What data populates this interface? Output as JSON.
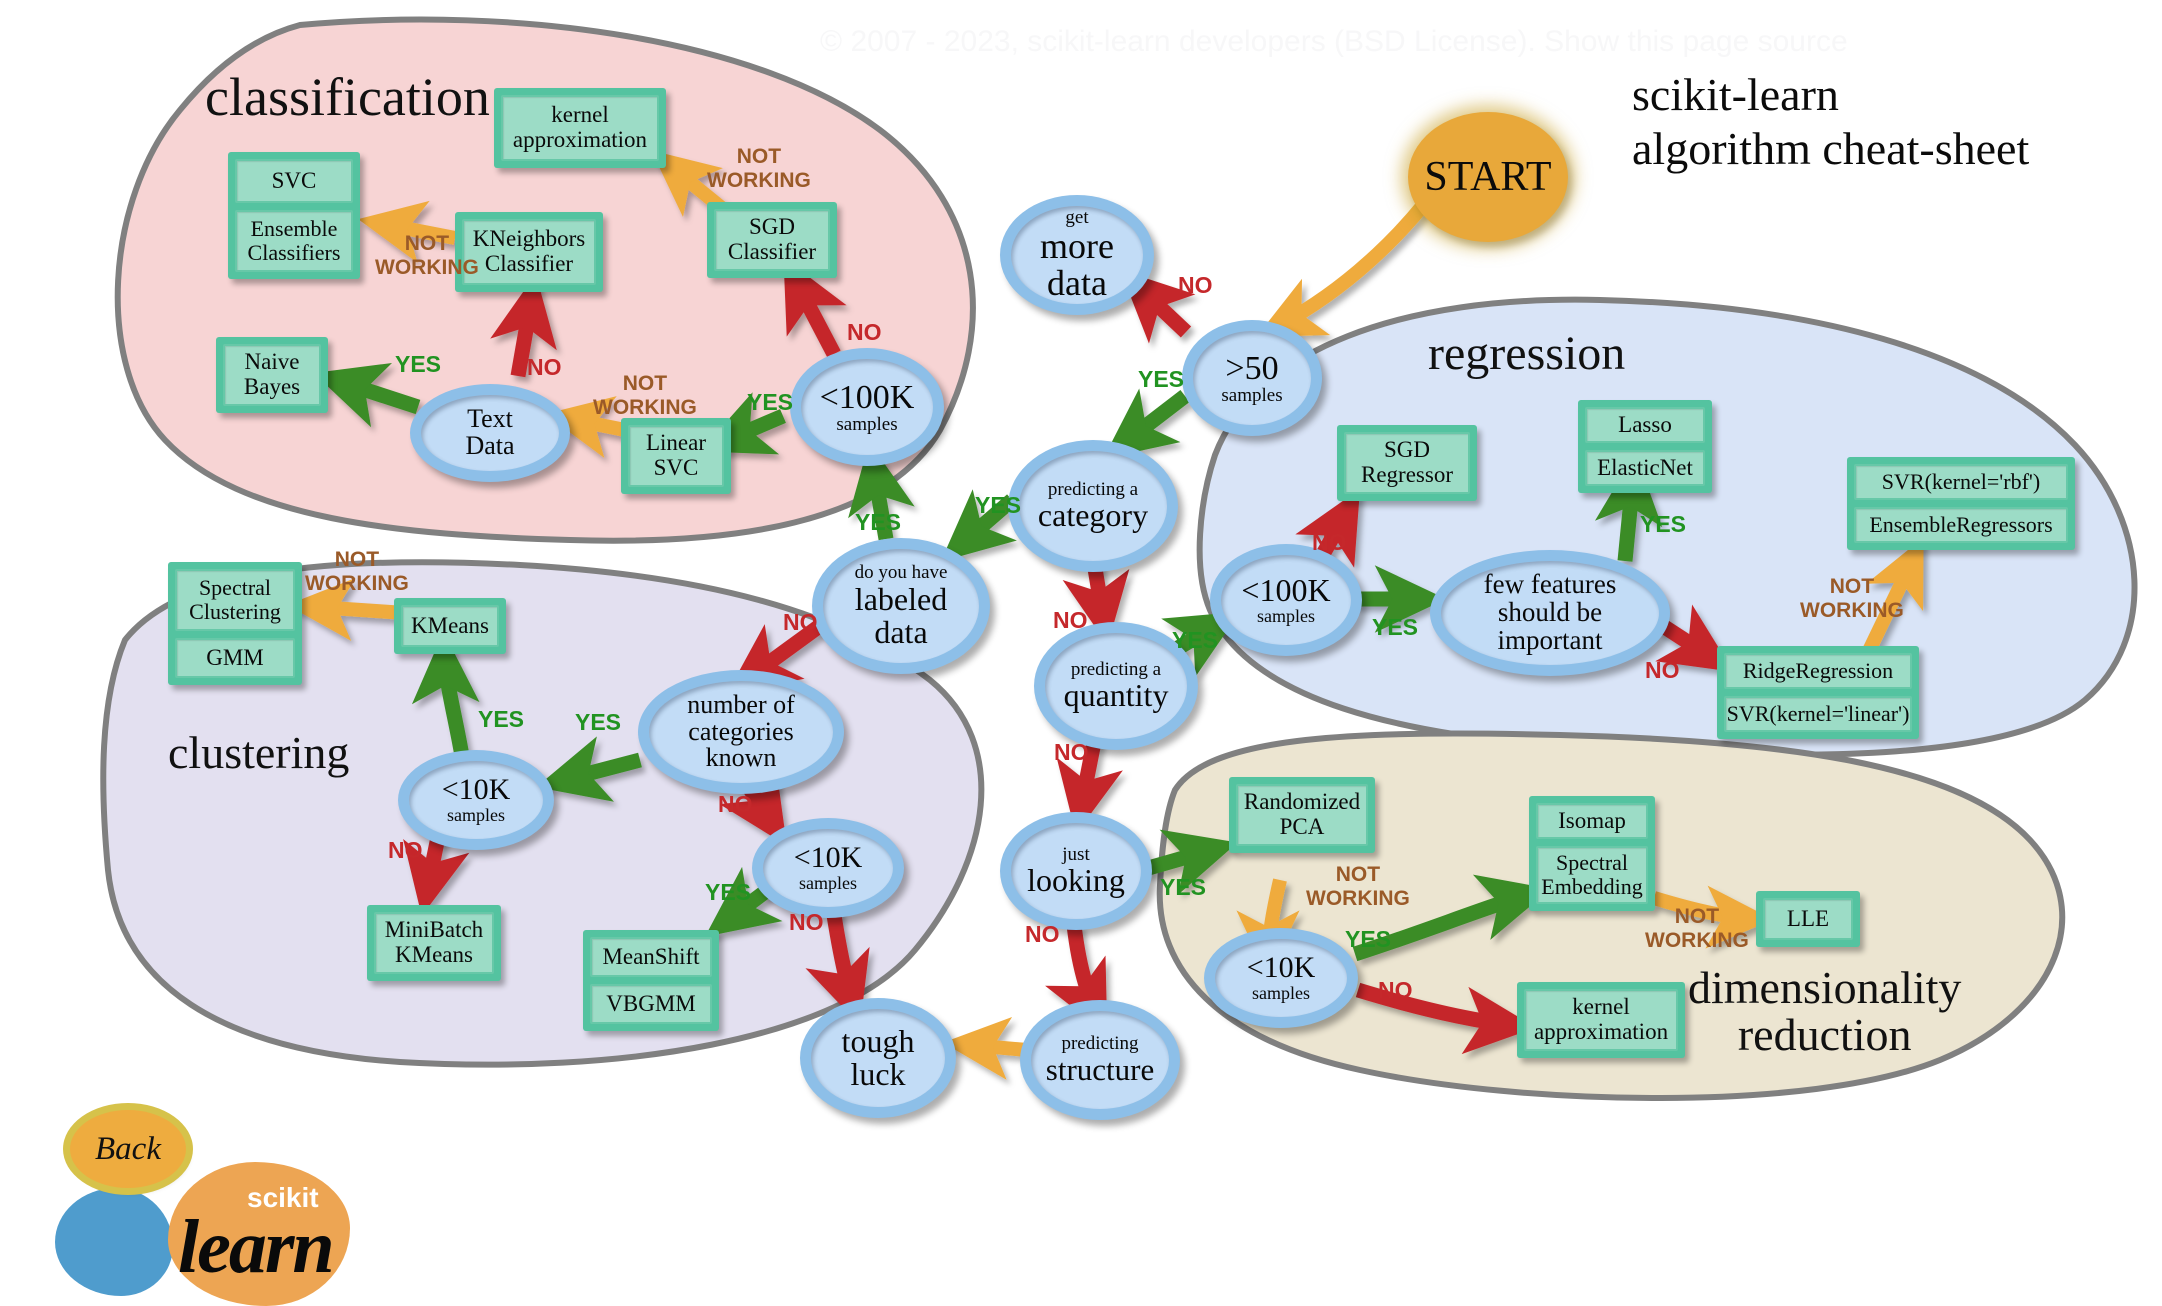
{
  "meta": {
    "watermark": "© 2007 - 2023, scikit-learn developers (BSD License). Show this page source",
    "title": "scikit-learn\nalgorithm cheat-sheet"
  },
  "colors": {
    "classification_fill": "#f7d4d4",
    "clustering_fill": "#e3e0f0",
    "regression_fill": "#d9e4f7",
    "dimreduction_fill": "#ece5d1",
    "region_stroke": "#808080",
    "box_border": "#54c3a0",
    "box_fill": "#9cdcc6",
    "node_ring": "#8dbfe8",
    "node_fill": "#c2dcf6",
    "start_fill": "#e8a83a",
    "arrow_yes": "#3a8c27",
    "arrow_no": "#c5282b",
    "arrow_notworking": "#efab3c",
    "label_yes": "#219321",
    "label_no": "#c5282b",
    "label_notworking": "#9a5a28"
  },
  "regions": [
    {
      "id": "classification",
      "label": "classification"
    },
    {
      "id": "clustering",
      "label": "clustering"
    },
    {
      "id": "regression",
      "label": "regression"
    },
    {
      "id": "dimensionality_reduction",
      "label": "dimensionality\nreduction"
    }
  ],
  "start": {
    "label": "START"
  },
  "logo": {
    "back_label": "Back",
    "scikit": "scikit",
    "learn": "learn"
  },
  "nodes": [
    {
      "id": "more_data",
      "sub": "get",
      "main": "more\ndata"
    },
    {
      "id": "gt50",
      "sub": "",
      "main": ">50",
      "post": "samples"
    },
    {
      "id": "predict_category",
      "sub": "predicting a",
      "main": "category"
    },
    {
      "id": "labeled_data",
      "sub": "do you have",
      "main": "labeled\ndata"
    },
    {
      "id": "predict_quantity",
      "sub": "predicting a",
      "main": "quantity"
    },
    {
      "id": "just_looking",
      "sub": "just",
      "main": "looking"
    },
    {
      "id": "predict_structure",
      "sub": "predicting",
      "main": "structure"
    },
    {
      "id": "tough_luck",
      "sub": "",
      "main": "tough\nluck"
    },
    {
      "id": "clf_lt100k",
      "sub": "",
      "main": "<100K",
      "post": "samples"
    },
    {
      "id": "text_data",
      "sub": "",
      "main": "Text\nData"
    },
    {
      "id": "reg_lt100k",
      "sub": "",
      "main": "<100K",
      "post": "samples"
    },
    {
      "id": "few_features",
      "sub": "",
      "main": "few features\nshould be\nimportant"
    },
    {
      "id": "num_categories",
      "sub": "",
      "main": "number of\ncategories\nknown"
    },
    {
      "id": "clu_lt10k_a",
      "sub": "",
      "main": "<10K",
      "post": "samples"
    },
    {
      "id": "clu_lt10k_b",
      "sub": "",
      "main": "<10K",
      "post": "samples"
    },
    {
      "id": "dim_lt10k",
      "sub": "",
      "main": "<10K",
      "post": "samples"
    }
  ],
  "boxes": [
    {
      "id": "kernel_approx_clf",
      "cells": [
        "kernel\napproximation"
      ]
    },
    {
      "id": "svc_ensemble",
      "cells": [
        "SVC",
        "Ensemble\nClassifiers"
      ]
    },
    {
      "id": "kneighbors",
      "cells": [
        "KNeighbors\nClassifier"
      ]
    },
    {
      "id": "sgd_classifier",
      "cells": [
        "SGD\nClassifier"
      ]
    },
    {
      "id": "naive_bayes",
      "cells": [
        "Naive\nBayes"
      ]
    },
    {
      "id": "linear_svc",
      "cells": [
        "Linear\nSVC"
      ]
    },
    {
      "id": "spectral_gmm",
      "cells": [
        "Spectral\nClustering",
        "GMM"
      ]
    },
    {
      "id": "kmeans",
      "cells": [
        "KMeans"
      ]
    },
    {
      "id": "minibatch_kmeans",
      "cells": [
        "MiniBatch\nKMeans"
      ]
    },
    {
      "id": "meanshift_vbgmm",
      "cells": [
        "MeanShift",
        "VBGMM"
      ]
    },
    {
      "id": "sgd_regressor",
      "cells": [
        "SGD\nRegressor"
      ]
    },
    {
      "id": "lasso_elasticnet",
      "cells": [
        "Lasso",
        "ElasticNet"
      ]
    },
    {
      "id": "svr_rbf_ensemble",
      "cells": [
        "SVR(kernel='rbf')",
        "EnsembleRegressors"
      ]
    },
    {
      "id": "ridge_svrlinear",
      "cells": [
        "RidgeRegression",
        "SVR(kernel='linear')"
      ]
    },
    {
      "id": "randomized_pca",
      "cells": [
        "Randomized\nPCA"
      ]
    },
    {
      "id": "isomap_spectral",
      "cells": [
        "Isomap",
        "Spectral\nEmbedding"
      ]
    },
    {
      "id": "lle",
      "cells": [
        "LLE"
      ]
    },
    {
      "id": "kernel_approx_dim",
      "cells": [
        "kernel\napproximation"
      ]
    }
  ],
  "edge_labels": [
    {
      "id": "lbl_gt50_no",
      "text": "NO",
      "kind": "no"
    },
    {
      "id": "lbl_gt50_yes",
      "text": "YES",
      "kind": "yes"
    },
    {
      "id": "lbl_cat_yes",
      "text": "YES",
      "kind": "yes"
    },
    {
      "id": "lbl_cat_no",
      "text": "NO",
      "kind": "no"
    },
    {
      "id": "lbl_lab_yes",
      "text": "YES",
      "kind": "yes"
    },
    {
      "id": "lbl_lab_no",
      "text": "NO",
      "kind": "no"
    },
    {
      "id": "lbl_qty_yes",
      "text": "YES",
      "kind": "yes"
    },
    {
      "id": "lbl_qty_no",
      "text": "NO",
      "kind": "no"
    },
    {
      "id": "lbl_look_yes",
      "text": "YES",
      "kind": "yes"
    },
    {
      "id": "lbl_look_no",
      "text": "NO",
      "kind": "no"
    },
    {
      "id": "lbl_clf100k_no",
      "text": "NO",
      "kind": "no"
    },
    {
      "id": "lbl_clf100k_yes",
      "text": "YES",
      "kind": "yes"
    },
    {
      "id": "lbl_lsvc_nw",
      "text": "NOT\nWORKING",
      "kind": "nw"
    },
    {
      "id": "lbl_text_yes",
      "text": "YES",
      "kind": "yes"
    },
    {
      "id": "lbl_text_no",
      "text": "NO",
      "kind": "no"
    },
    {
      "id": "lbl_knn_nw",
      "text": "NOT\nWORKING",
      "kind": "nw"
    },
    {
      "id": "lbl_sgd_nw",
      "text": "NOT\nWORKING",
      "kind": "nw"
    },
    {
      "id": "lbl_reg100k_no",
      "text": "NO",
      "kind": "no"
    },
    {
      "id": "lbl_reg100k_yes",
      "text": "YES",
      "kind": "yes"
    },
    {
      "id": "lbl_few_yes",
      "text": "YES",
      "kind": "yes"
    },
    {
      "id": "lbl_few_no",
      "text": "NO",
      "kind": "no"
    },
    {
      "id": "lbl_ridge_nw",
      "text": "NOT\nWORKING",
      "kind": "nw"
    },
    {
      "id": "lbl_numcat_yes",
      "text": "YES",
      "kind": "yes"
    },
    {
      "id": "lbl_numcat_no",
      "text": "NO",
      "kind": "no"
    },
    {
      "id": "lbl_clu10ka_yes",
      "text": "YES",
      "kind": "yes"
    },
    {
      "id": "lbl_clu10ka_no",
      "text": "NO",
      "kind": "no"
    },
    {
      "id": "lbl_clu10kb_yes",
      "text": "YES",
      "kind": "yes"
    },
    {
      "id": "lbl_clu10kb_no",
      "text": "NO",
      "kind": "no"
    },
    {
      "id": "lbl_kmeans_nw",
      "text": "NOT\nWORKING",
      "kind": "nw"
    },
    {
      "id": "lbl_rpca_nw",
      "text": "NOT\nWORKING",
      "kind": "nw"
    },
    {
      "id": "lbl_dim10k_yes",
      "text": "YES",
      "kind": "yes"
    },
    {
      "id": "lbl_dim10k_no",
      "text": "NO",
      "kind": "no"
    },
    {
      "id": "lbl_spec_nw",
      "text": "NOT\nWORKING",
      "kind": "nw"
    }
  ]
}
